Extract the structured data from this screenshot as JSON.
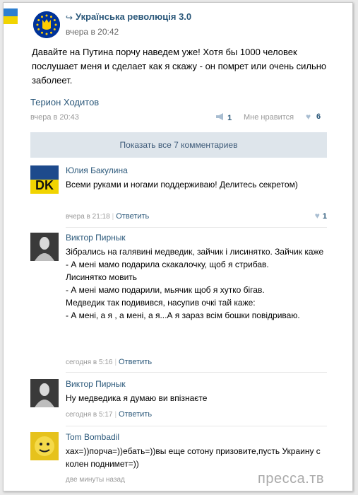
{
  "post": {
    "group_name": "Украïнська революцiя 3.0",
    "time": "вчера в 20:42",
    "text": "Давайте на Путина порчу наведем уже! Хотя бы 1000 человек послушает меня и сделает как я скажу - он помрет или очень сильно заболеет.",
    "author": "Терион Ходитов",
    "author_time": "вчера в 20:43",
    "share_count": "1",
    "like_label": "Мне нравится",
    "like_count": "6",
    "show_all": "Показать все 7 комментариев",
    "colors": {
      "link": "#2b587a",
      "bar": "#dee5eb",
      "eu_blue": "#003399"
    }
  },
  "comments": [
    {
      "name": "Юлия Бакулина",
      "text": "Всеми руками и ногами поддерживаю! Делитесь секретом)",
      "time": "вчера в 21:18",
      "reply": "Ответить",
      "likes": "1"
    },
    {
      "name": "Виктор Пирнык",
      "text": "Зiбрались на галявинi медведик, зайчик i лисинятко. Зайчик каже\n- А менi мамо подарила скакалочку, щоб я стрибав.\nЛисинятко мовить\n- А менi мамо подарили, мьячик щоб я хутко бiгав.\nМедведик так подивився, насупив очкi тай каже:\n- А менi, а я , а менi, а я...А я зараз всiм бошки повiдриваю.",
      "time": "сегодня в 5:16",
      "reply": "Ответить"
    },
    {
      "name": "Виктор Пирнык",
      "text": "Ну медведика я думаю ви впiзнаєте",
      "time": "сегодня в 5:17",
      "reply": "Ответить"
    },
    {
      "name": "Tom Bombadil",
      "text": "хах=))порча=))ебать=))вы еще сотону призовите,пусть Украину с колен поднимет=))",
      "time": "две минуты назад"
    }
  ],
  "watermark": "пресса.тв"
}
